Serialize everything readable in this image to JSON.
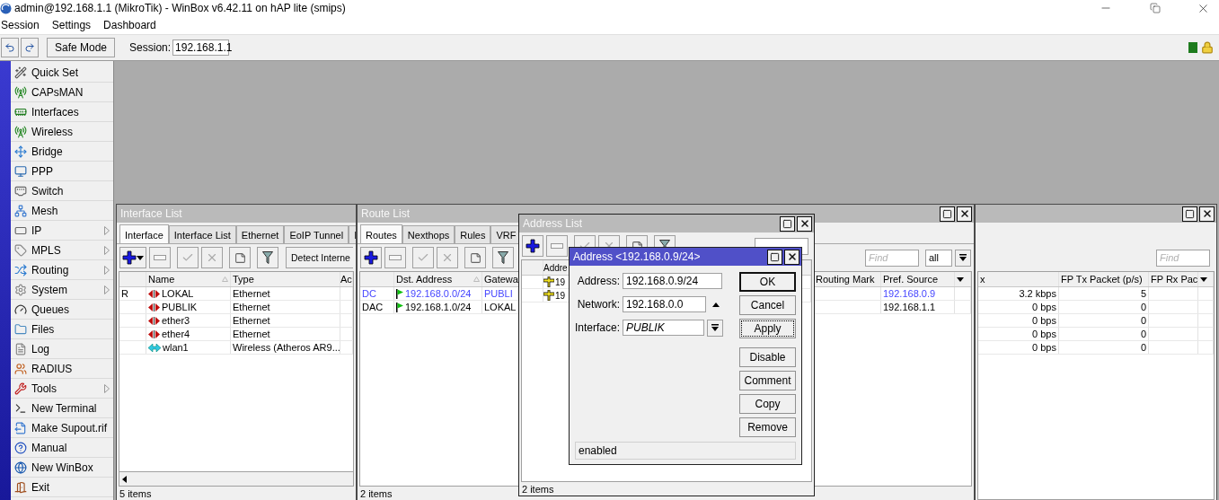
{
  "window": {
    "title": "admin@192.168.1.1 (MikroTik) - WinBox v6.42.11 on hAP lite (smips)"
  },
  "menu": [
    "Session",
    "Settings",
    "Dashboard"
  ],
  "toolbar": {
    "safe_mode": "Safe Mode",
    "session_label": "Session:",
    "session_value": "192.168.1.1"
  },
  "sidebar": {
    "items": [
      {
        "label": "Quick Set",
        "submenu": false
      },
      {
        "label": "CAPsMAN",
        "submenu": false
      },
      {
        "label": "Interfaces",
        "submenu": false
      },
      {
        "label": "Wireless",
        "submenu": false
      },
      {
        "label": "Bridge",
        "submenu": false
      },
      {
        "label": "PPP",
        "submenu": false
      },
      {
        "label": "Switch",
        "submenu": false
      },
      {
        "label": "Mesh",
        "submenu": false
      },
      {
        "label": "IP",
        "submenu": true
      },
      {
        "label": "MPLS",
        "submenu": true
      },
      {
        "label": "Routing",
        "submenu": true
      },
      {
        "label": "System",
        "submenu": true
      },
      {
        "label": "Queues",
        "submenu": false
      },
      {
        "label": "Files",
        "submenu": false
      },
      {
        "label": "Log",
        "submenu": false
      },
      {
        "label": "RADIUS",
        "submenu": false
      },
      {
        "label": "Tools",
        "submenu": true
      },
      {
        "label": "New Terminal",
        "submenu": false
      },
      {
        "label": "Make Supout.rif",
        "submenu": false
      },
      {
        "label": "Manual",
        "submenu": false
      },
      {
        "label": "New WinBox",
        "submenu": false
      },
      {
        "label": "Exit",
        "submenu": false
      }
    ]
  },
  "interface_list": {
    "title": "Interface List",
    "tabs": [
      {
        "label": "Interface",
        "selected": true
      },
      {
        "label": "Interface List",
        "selected": false
      },
      {
        "label": "Ethernet",
        "selected": false
      },
      {
        "label": "EoIP Tunnel",
        "selected": false
      },
      {
        "label": "I",
        "selected": false
      }
    ],
    "detect_button": "Detect Interne",
    "columns": [
      "Name",
      "Type",
      "Ac"
    ],
    "rows": [
      {
        "flag": "R",
        "name": "LOKAL",
        "kind": "ethernet",
        "type": "Ethernet"
      },
      {
        "name": "PUBLIK",
        "kind": "ethernet",
        "type": "Ethernet"
      },
      {
        "name": "ether3",
        "kind": "ethernet",
        "type": "Ethernet"
      },
      {
        "name": "ether4",
        "kind": "ethernet",
        "type": "Ethernet"
      },
      {
        "name": "wlan1",
        "kind": "wireless",
        "type": "Wireless (Atheros AR9..."
      }
    ],
    "status": "5 items"
  },
  "route_list": {
    "title": "Route List",
    "tabs": [
      {
        "label": "Routes",
        "selected": true
      },
      {
        "label": "Nexthops",
        "selected": false
      },
      {
        "label": "Rules",
        "selected": false
      },
      {
        "label": "VRF",
        "selected": false
      }
    ],
    "find_placeholder": "Find",
    "filter_value": "all",
    "columns": [
      "Dst. Address",
      "Gatewa",
      "Routing Mark",
      "Pref. Source"
    ],
    "rows": [
      {
        "flag": "DC",
        "dst": "192.168.0.0/24",
        "gateway": "PUBLI",
        "pref_source": "192.168.0.9",
        "color": "#4646ff"
      },
      {
        "flag": "DAC",
        "dst": "192.168.1.0/24",
        "gateway": "LOKAL",
        "pref_source": "192.168.1.1",
        "color": "#000000"
      }
    ],
    "status": "2 items"
  },
  "interface_stats": {
    "find_placeholder": "Find",
    "columns": [
      "x",
      "FP Tx Packet (p/s)",
      "FP Rx Pac"
    ],
    "rows": [
      {
        "rate": "3.2 kbps",
        "packets": "5"
      },
      {
        "rate": "0 bps",
        "packets": "0"
      },
      {
        "rate": "0 bps",
        "packets": "0"
      },
      {
        "rate": "0 bps",
        "packets": "0"
      },
      {
        "rate": "0 bps",
        "packets": "0"
      }
    ]
  },
  "address_list": {
    "title": "Address List",
    "column": "Addre",
    "rows": [
      {
        "address": "19"
      },
      {
        "address": "19"
      }
    ],
    "status": "2 items"
  },
  "address_dialog": {
    "title": "Address <192.168.0.9/24>",
    "fields": [
      {
        "label": "Address:",
        "value": "192.168.0.9/24",
        "kind": "text"
      },
      {
        "label": "Network:",
        "value": "192.168.0.0",
        "kind": "collapse"
      },
      {
        "label": "Interface:",
        "value": "PUBLIK",
        "kind": "select"
      }
    ],
    "buttons": [
      {
        "label": "OK",
        "kind": "default"
      },
      {
        "label": "Cancel",
        "kind": "plain"
      },
      {
        "label": "Apply",
        "kind": "focused"
      }
    ],
    "actions": [
      "Disable",
      "Comment",
      "Copy",
      "Remove"
    ],
    "status": "enabled"
  }
}
